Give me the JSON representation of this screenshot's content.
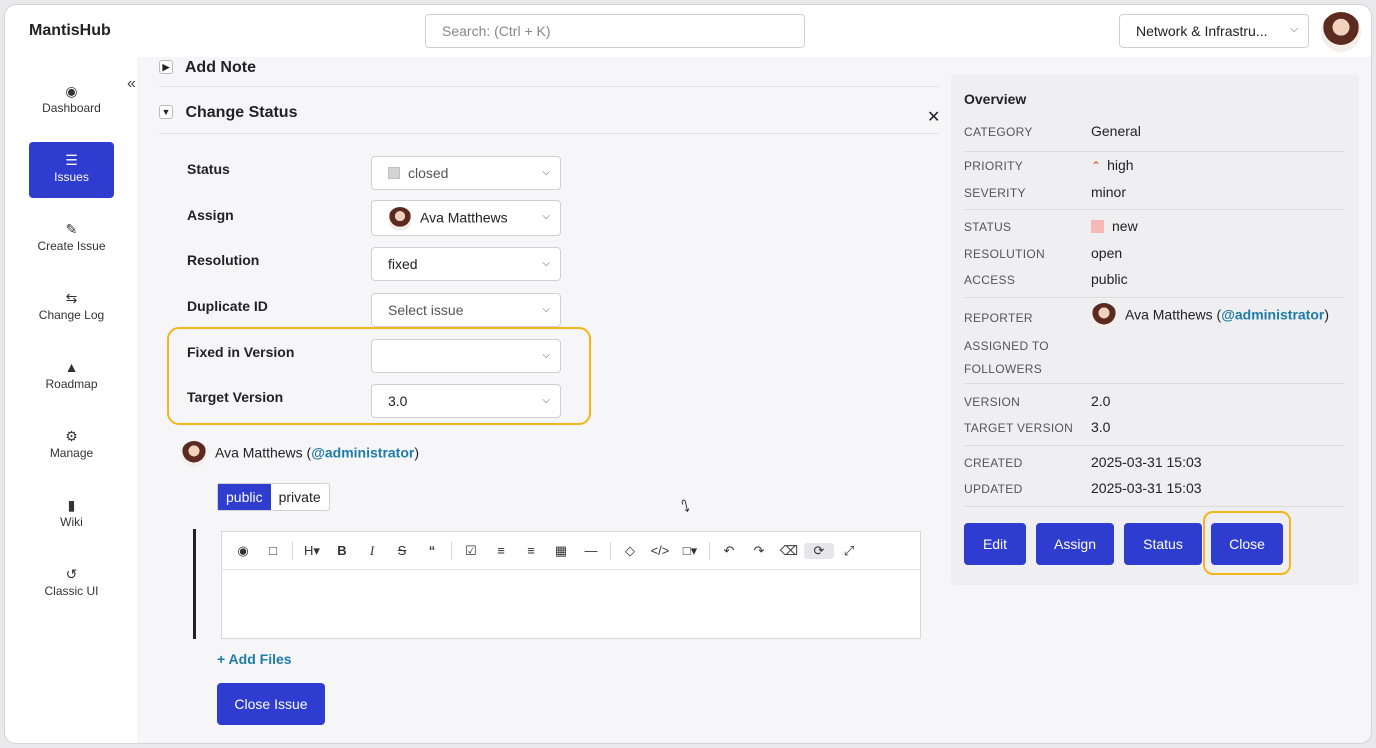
{
  "app": {
    "name": "MantisHub"
  },
  "search": {
    "placeholder": "Search: (Ctrl + K)"
  },
  "project_selector": {
    "value": "Network & Infrastru..."
  },
  "sidebar": {
    "items": [
      {
        "label": "Dashboard",
        "icon": "dashboard-icon"
      },
      {
        "label": "Issues",
        "icon": "list-icon",
        "active": true
      },
      {
        "label": "Create Issue",
        "icon": "edit-icon"
      },
      {
        "label": "Change Log",
        "icon": "change-log-icon"
      },
      {
        "label": "Roadmap",
        "icon": "roadmap-icon"
      },
      {
        "label": "Manage",
        "icon": "gears-icon"
      },
      {
        "label": "Wiki",
        "icon": "document-icon"
      },
      {
        "label": "Classic UI",
        "icon": "history-icon"
      }
    ]
  },
  "sections": {
    "add_note": "Add Note",
    "change_status": "Change Status"
  },
  "form": {
    "status": {
      "label": "Status",
      "value": "closed"
    },
    "assign": {
      "label": "Assign",
      "value": "Ava Matthews"
    },
    "resolution": {
      "label": "Resolution",
      "value": "fixed"
    },
    "duplicate_id": {
      "label": "Duplicate ID",
      "placeholder": "Select issue"
    },
    "fixed_in_version": {
      "label": "Fixed in Version",
      "value": ""
    },
    "target_version": {
      "label": "Target Version",
      "value": "3.0"
    }
  },
  "comment": {
    "user_name": "Ava Matthews",
    "user_handle": "@administrator",
    "visibility": [
      "public",
      "private"
    ],
    "visibility_selected": "public"
  },
  "add_files": "+ Add Files",
  "close_issue_button": "Close Issue",
  "overview": {
    "title": "Overview",
    "category_label": "CATEGORY",
    "category": "General",
    "priority_label": "PRIORITY",
    "priority": "high",
    "severity_label": "SEVERITY",
    "severity": "minor",
    "status_label": "STATUS",
    "status": "new",
    "resolution_label": "RESOLUTION",
    "resolution": "open",
    "access_label": "ACCESS",
    "access": "public",
    "reporter_label": "REPORTER",
    "reporter_name": "Ava Matthews",
    "reporter_handle": "@administrator",
    "assigned_to_label": "ASSIGNED TO",
    "followers_label": "FOLLOWERS",
    "version_label": "VERSION",
    "version": "2.0",
    "target_version_label": "TARGET VERSION",
    "target_version": "3.0",
    "created_label": "CREATED",
    "created": "2025-03-31 15:03",
    "updated_label": "UPDATED",
    "updated": "2025-03-31 15:03",
    "buttons": {
      "edit": "Edit",
      "assign": "Assign",
      "status": "Status",
      "close": "Close"
    }
  },
  "colors": {
    "primary": "#2e3ccf",
    "highlight": "#f2b61c",
    "link": "#1f7ca8",
    "status_new": "#f7b8b8"
  }
}
